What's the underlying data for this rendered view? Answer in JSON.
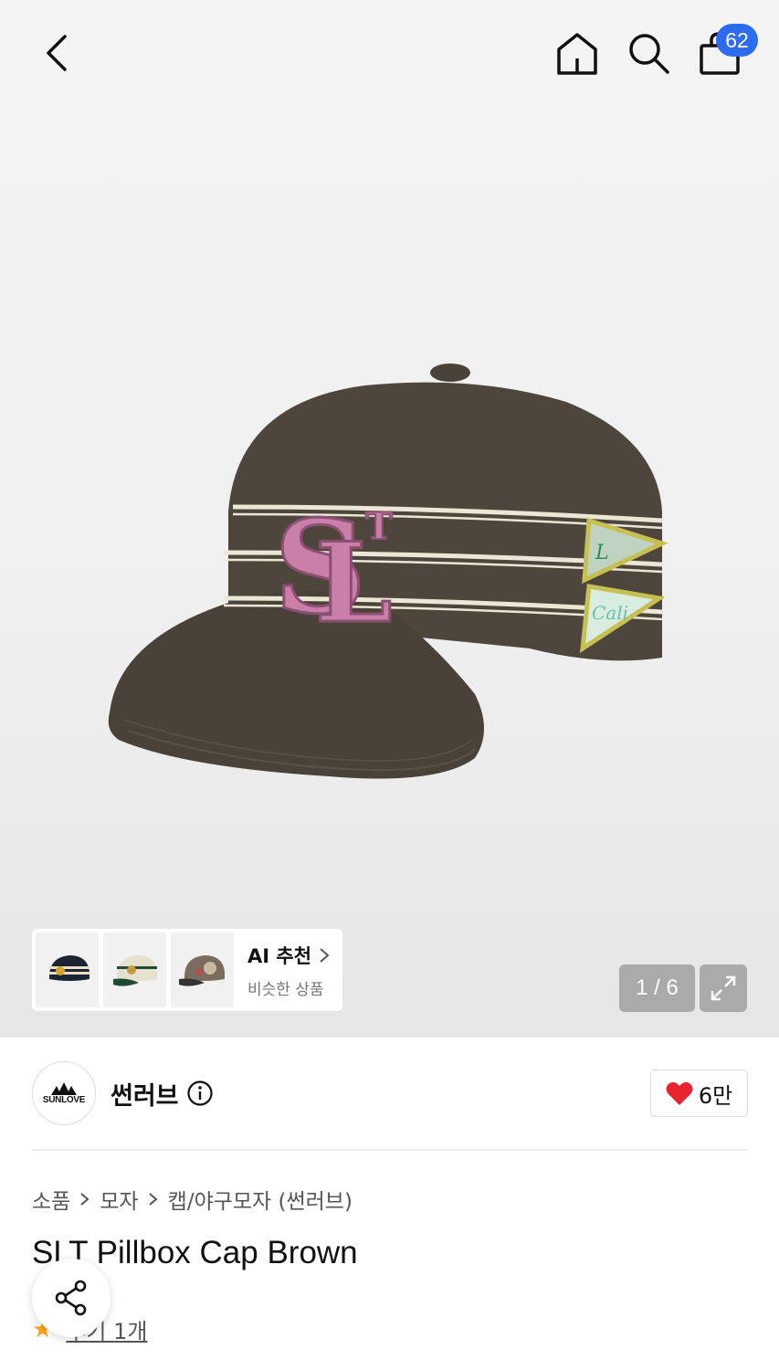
{
  "header": {
    "cart_count": "62"
  },
  "gallery": {
    "counter": "1 / 6",
    "ai_card": {
      "title": "AI 추천",
      "subtitle": "비슷한 상품"
    }
  },
  "brand": {
    "logo_text": "SUNLOVE",
    "name": "썬러브",
    "likes": "6만"
  },
  "breadcrumb": [
    "소품",
    "모자",
    "캡/야구모자 (썬러브)"
  ],
  "product": {
    "title": "SLT Pillbox Cap Brown"
  },
  "reviews": {
    "label": "후기 1개"
  },
  "colors": {
    "badge": "#2d6bf0",
    "heart": "#e8222e",
    "star": "#f7a51c",
    "cap": "#4e463d",
    "stripe": "#ece6d6",
    "logo_pink": "#c97fa8"
  }
}
